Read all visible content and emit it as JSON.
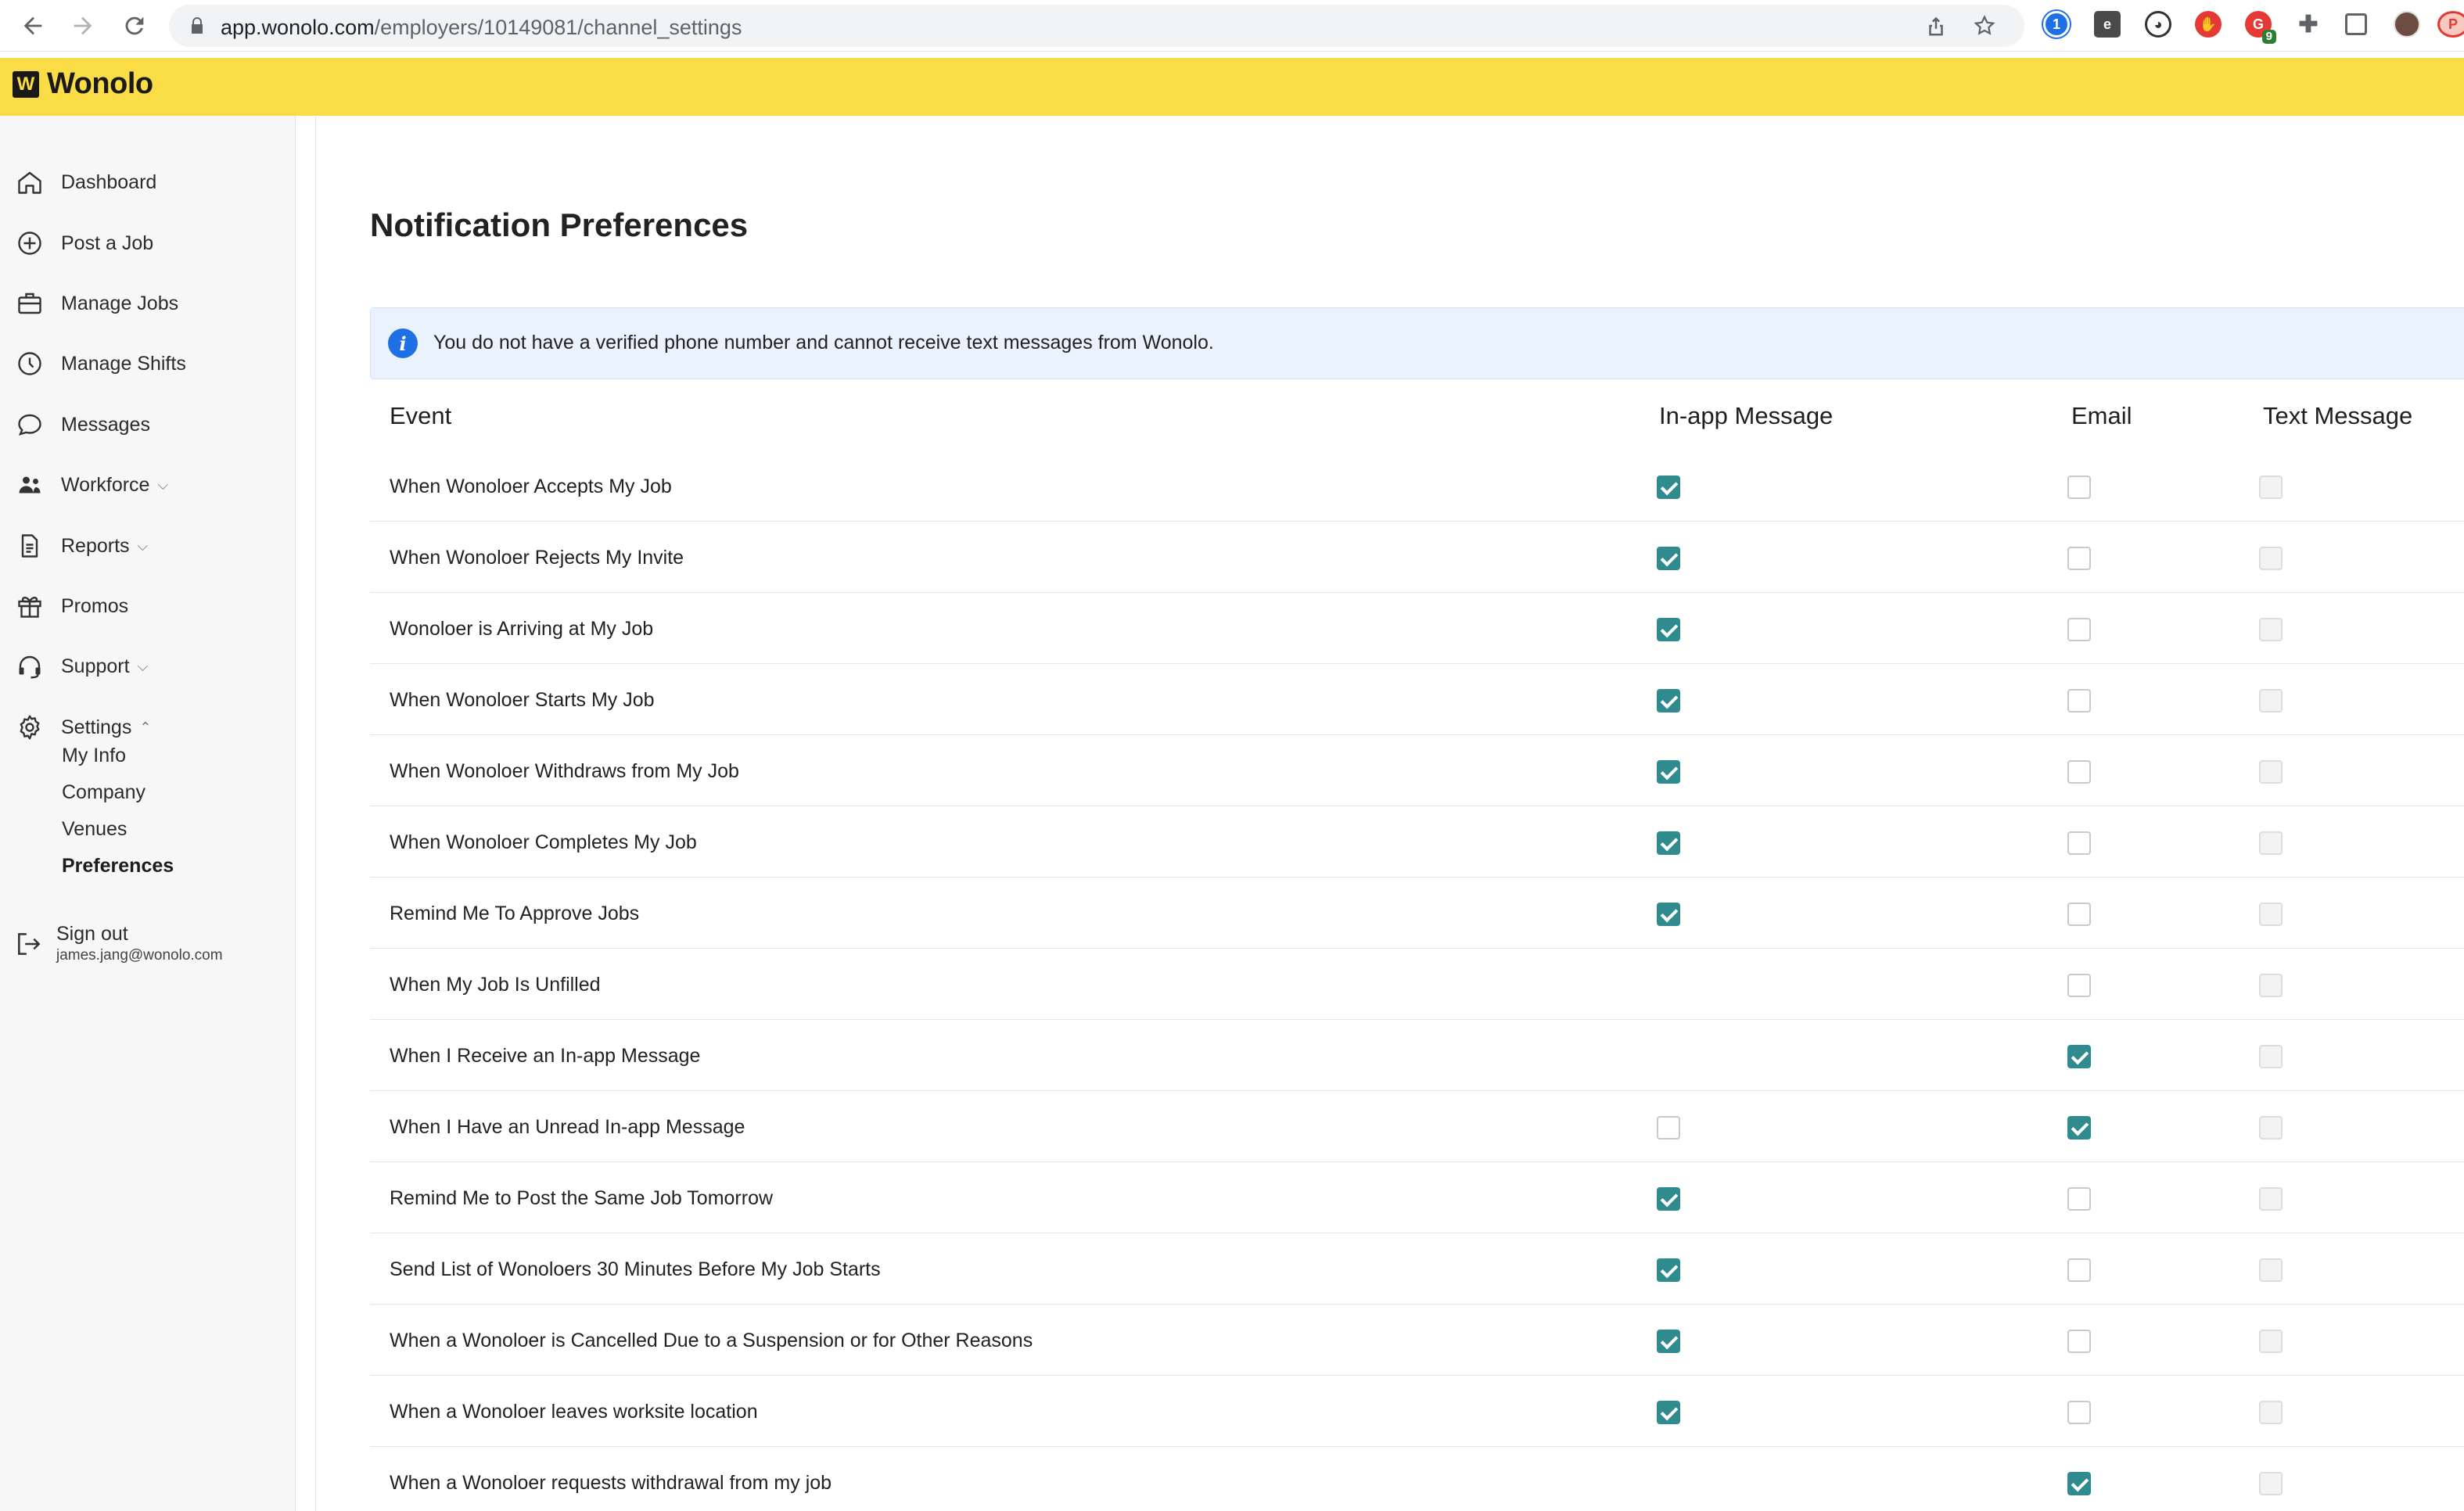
{
  "browser": {
    "url_host": "app.wonolo.com",
    "url_path": "/employers/10149081/channel_settings",
    "extension_badge": "9"
  },
  "brand": {
    "logo_mark": "W",
    "logo_text": "Wonolo",
    "bar_color": "#f9dc46"
  },
  "sidebar": {
    "items": [
      {
        "label": "Dashboard",
        "icon": "home-icon"
      },
      {
        "label": "Post a Job",
        "icon": "plus-circle-icon"
      },
      {
        "label": "Manage Jobs",
        "icon": "briefcase-icon"
      },
      {
        "label": "Manage Shifts",
        "icon": "clock-icon"
      },
      {
        "label": "Messages",
        "icon": "chat-bubble-icon"
      },
      {
        "label": "Workforce",
        "icon": "people-icon",
        "chevron": "⌵"
      },
      {
        "label": "Reports",
        "icon": "document-icon",
        "chevron": "⌵"
      },
      {
        "label": "Promos",
        "icon": "gift-icon"
      },
      {
        "label": "Support",
        "icon": "headset-icon",
        "chevron": "⌵"
      },
      {
        "label": "Settings",
        "icon": "gear-icon",
        "chevron": "⌃"
      }
    ],
    "settings_sub": [
      "My Info",
      "Company",
      "Venues",
      "Preferences"
    ],
    "active_sub": "Preferences",
    "signout": {
      "label": "Sign out",
      "email": "james.jang@wonolo.com"
    }
  },
  "main": {
    "title": "Notification Preferences",
    "alert": "You do not have a verified phone number and cannot receive text messages from Wonolo.",
    "columns": {
      "event": "Event",
      "inapp": "In-app Message",
      "email": "Email",
      "text": "Text Message"
    },
    "accent_color": "#2f8b8e",
    "rows": [
      {
        "event": "When Wonoloer Accepts My Job",
        "inapp": "on",
        "email": "off",
        "text": "dis"
      },
      {
        "event": "When Wonoloer Rejects My Invite",
        "inapp": "on",
        "email": "off",
        "text": "dis"
      },
      {
        "event": "Wonoloer is Arriving at My Job",
        "inapp": "on",
        "email": "off",
        "text": "dis"
      },
      {
        "event": "When Wonoloer Starts My Job",
        "inapp": "on",
        "email": "off",
        "text": "dis"
      },
      {
        "event": "When Wonoloer Withdraws from My Job",
        "inapp": "on",
        "email": "off",
        "text": "dis"
      },
      {
        "event": "When Wonoloer Completes My Job",
        "inapp": "on",
        "email": "off",
        "text": "dis"
      },
      {
        "event": "Remind Me To Approve Jobs",
        "inapp": "on",
        "email": "off",
        "text": "dis"
      },
      {
        "event": "When My Job Is Unfilled",
        "inapp": "none",
        "email": "off",
        "text": "dis"
      },
      {
        "event": "When I Receive an In-app Message",
        "inapp": "none",
        "email": "on",
        "text": "dis"
      },
      {
        "event": "When I Have an Unread In-app Message",
        "inapp": "off",
        "email": "on",
        "text": "dis"
      },
      {
        "event": "Remind Me to Post the Same Job Tomorrow",
        "inapp": "on",
        "email": "off",
        "text": "dis"
      },
      {
        "event": "Send List of Wonoloers 30 Minutes Before My Job Starts",
        "inapp": "on",
        "email": "off",
        "text": "dis"
      },
      {
        "event": "When a Wonoloer is Cancelled Due to a Suspension or for Other Reasons",
        "inapp": "on",
        "email": "off",
        "text": "dis"
      },
      {
        "event": "When a Wonoloer leaves worksite location",
        "inapp": "on",
        "email": "off",
        "text": "dis"
      },
      {
        "event": "When a Wonoloer requests withdrawal from my job",
        "inapp": "none",
        "email": "on",
        "text": "dis"
      }
    ]
  }
}
